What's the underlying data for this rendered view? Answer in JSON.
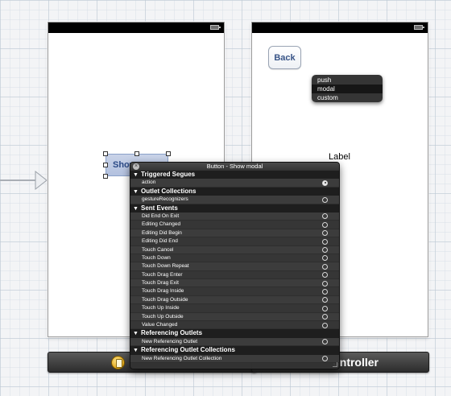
{
  "canvas": {
    "background": "#f3f4f6"
  },
  "right_scene": {
    "back_button_label": "Back",
    "label_text": "Label",
    "segue_menu": [
      "push",
      "modal",
      "custom"
    ],
    "segue_selected": "modal"
  },
  "left_scene": {
    "button_label": "Show"
  },
  "dock": {
    "right_title": "ontroller"
  },
  "inspector": {
    "title": "Button - Show modal",
    "sections": [
      {
        "name": "Triggered Segues",
        "rows": [
          {
            "label": "action",
            "connected": true
          }
        ]
      },
      {
        "name": "Outlet Collections",
        "rows": [
          {
            "label": "gestureRecognizers",
            "connected": false
          }
        ]
      },
      {
        "name": "Sent Events",
        "rows": [
          {
            "label": "Did End On Exit",
            "connected": false
          },
          {
            "label": "Editing Changed",
            "connected": false
          },
          {
            "label": "Editing Did Begin",
            "connected": false
          },
          {
            "label": "Editing Did End",
            "connected": false
          },
          {
            "label": "Touch Cancel",
            "connected": false
          },
          {
            "label": "Touch Down",
            "connected": false
          },
          {
            "label": "Touch Down Repeat",
            "connected": false
          },
          {
            "label": "Touch Drag Enter",
            "connected": false
          },
          {
            "label": "Touch Drag Exit",
            "connected": false
          },
          {
            "label": "Touch Drag Inside",
            "connected": false
          },
          {
            "label": "Touch Drag Outside",
            "connected": false
          },
          {
            "label": "Touch Up Inside",
            "connected": false
          },
          {
            "label": "Touch Up Outside",
            "connected": false
          },
          {
            "label": "Value Changed",
            "connected": false
          }
        ]
      },
      {
        "name": "Referencing Outlets",
        "rows": [
          {
            "label": "New Referencing Outlet",
            "connected": false
          }
        ]
      },
      {
        "name": "Referencing Outlet Collections",
        "rows": [
          {
            "label": "New Referencing Outlet Collection",
            "connected": false
          }
        ]
      }
    ]
  }
}
